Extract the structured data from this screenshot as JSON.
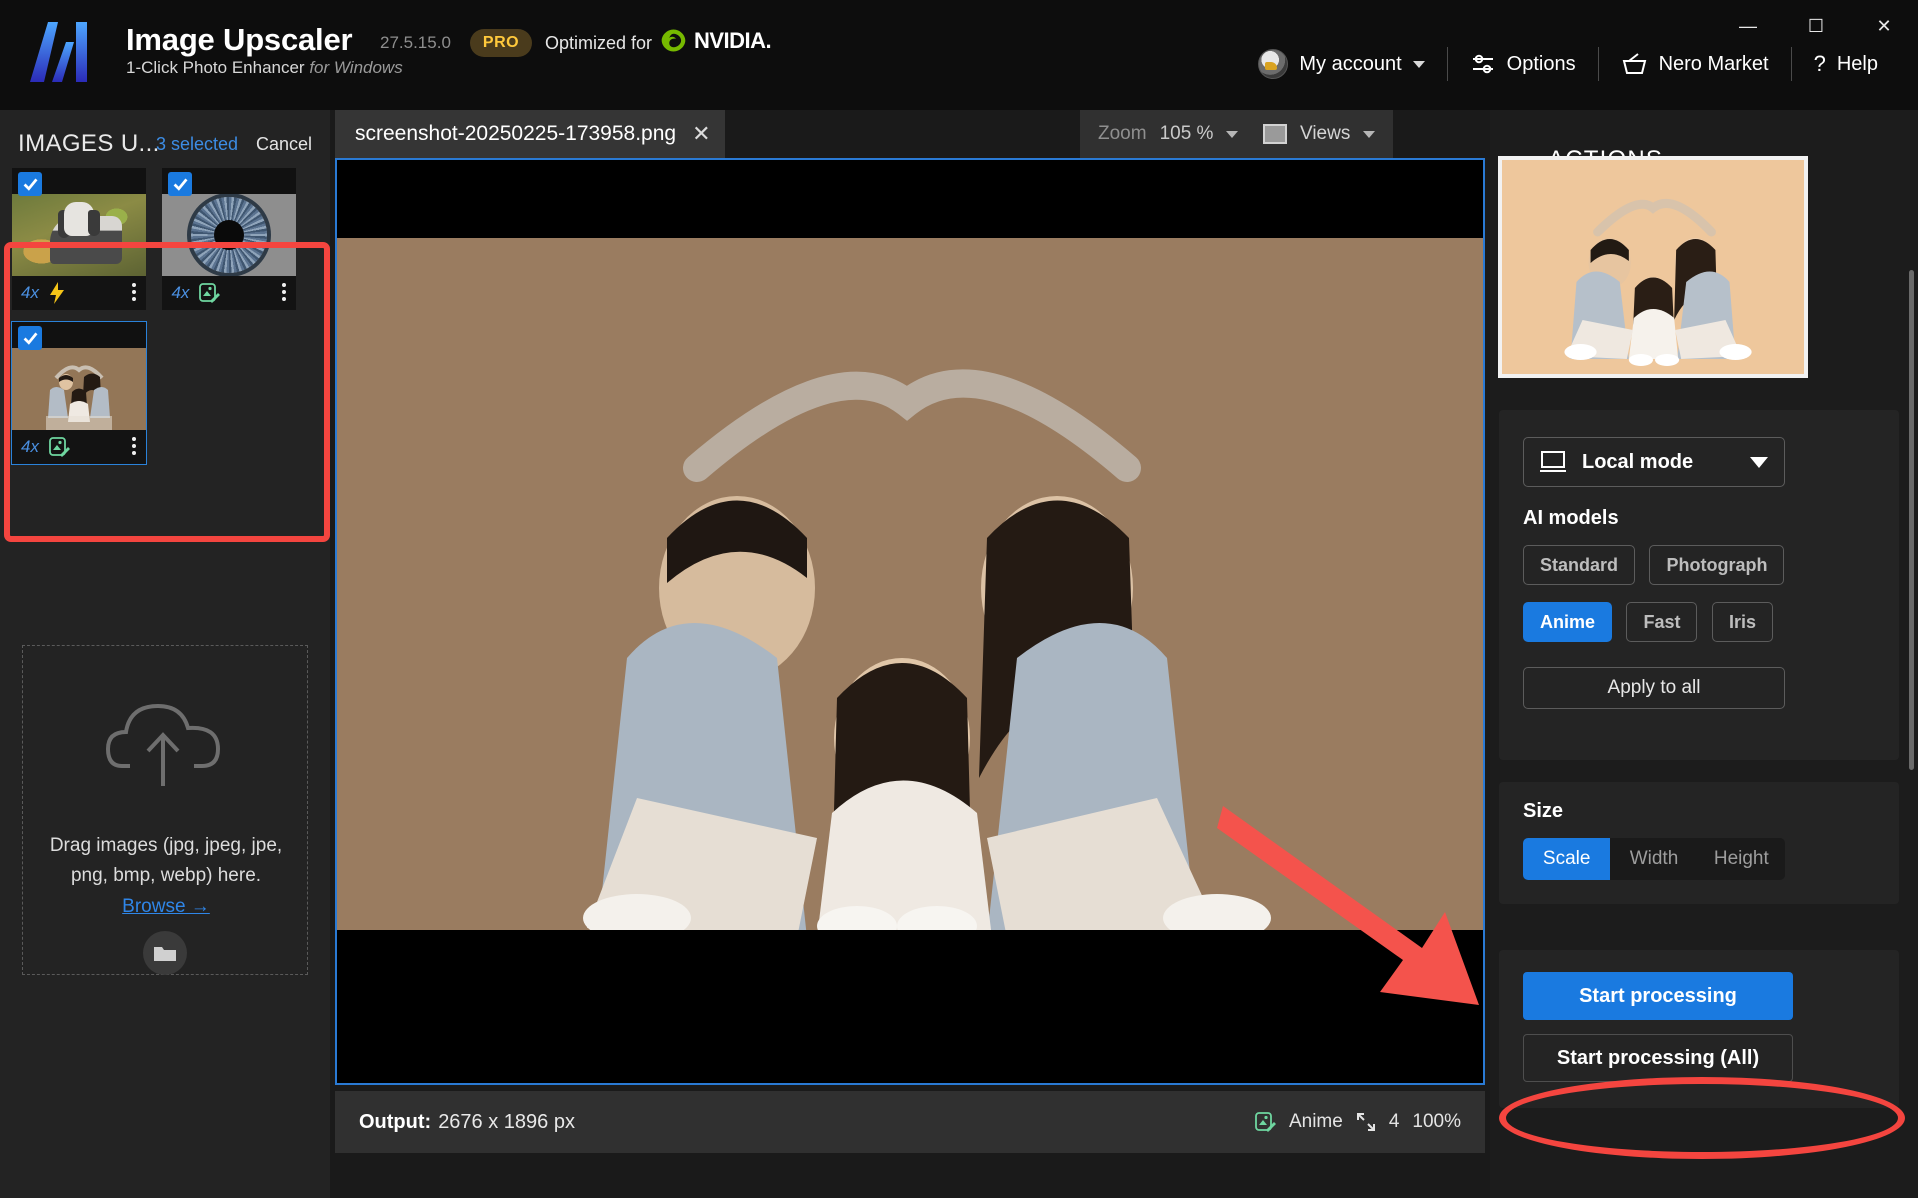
{
  "app": {
    "title": "Image Upscaler",
    "subtitle": "1-Click Photo Enhancer",
    "subtitle_italic": "for Windows",
    "version": "27.5.15.0",
    "pro_badge": "PRO",
    "optimized_for": "Optimized for",
    "gpu_vendor": "NVIDIA.",
    "accent": "#1a7ae0",
    "highlight": "#f4453f"
  },
  "window_controls": {
    "minimize": "—",
    "maximize": "☐",
    "close": "✕"
  },
  "header": {
    "account": "My account",
    "options": "Options",
    "market": "Nero Market",
    "help": "Help"
  },
  "sidebar": {
    "title": "IMAGES U...",
    "selected_count": "3 selected",
    "cancel": "Cancel",
    "cards": [
      {
        "scale": "4x",
        "icon": "lightning-icon",
        "selected": true,
        "active": false,
        "art": "dog"
      },
      {
        "scale": "4x",
        "icon": "image-edit-icon",
        "selected": true,
        "active": false,
        "art": "eye"
      },
      {
        "scale": "4x",
        "icon": "image-edit-icon",
        "selected": true,
        "active": true,
        "art": "family"
      }
    ],
    "dropzone": {
      "line1": "Drag images (jpg, jpeg, jpe,",
      "line2": "png, bmp, webp) here.",
      "browse": "Browse →"
    }
  },
  "center": {
    "tab_name": "screenshot-20250225-173958.png",
    "tab_close": "✕",
    "zoom_label": "Zoom",
    "zoom_value": "105 %",
    "views_label": "Views",
    "status": {
      "output_label": "Output:",
      "output_value": "2676 x 1896 px",
      "model": "Anime",
      "scale": "4",
      "quality": "100%"
    }
  },
  "actions": {
    "title": "ACTIONS",
    "mode": "Local mode",
    "ai_models_label": "AI models",
    "models": [
      {
        "label": "Standard",
        "active": false
      },
      {
        "label": "Photograph",
        "active": false
      },
      {
        "label": "Anime",
        "active": true
      },
      {
        "label": "Fast",
        "active": false
      },
      {
        "label": "Iris",
        "active": false
      }
    ],
    "apply_to_all": "Apply to all",
    "size_label": "Size",
    "size_options": [
      {
        "label": "Scale",
        "active": true
      },
      {
        "label": "Width",
        "active": false
      },
      {
        "label": "Height",
        "active": false
      }
    ],
    "start_processing": "Start processing",
    "start_processing_all": "Start processing (All)"
  }
}
